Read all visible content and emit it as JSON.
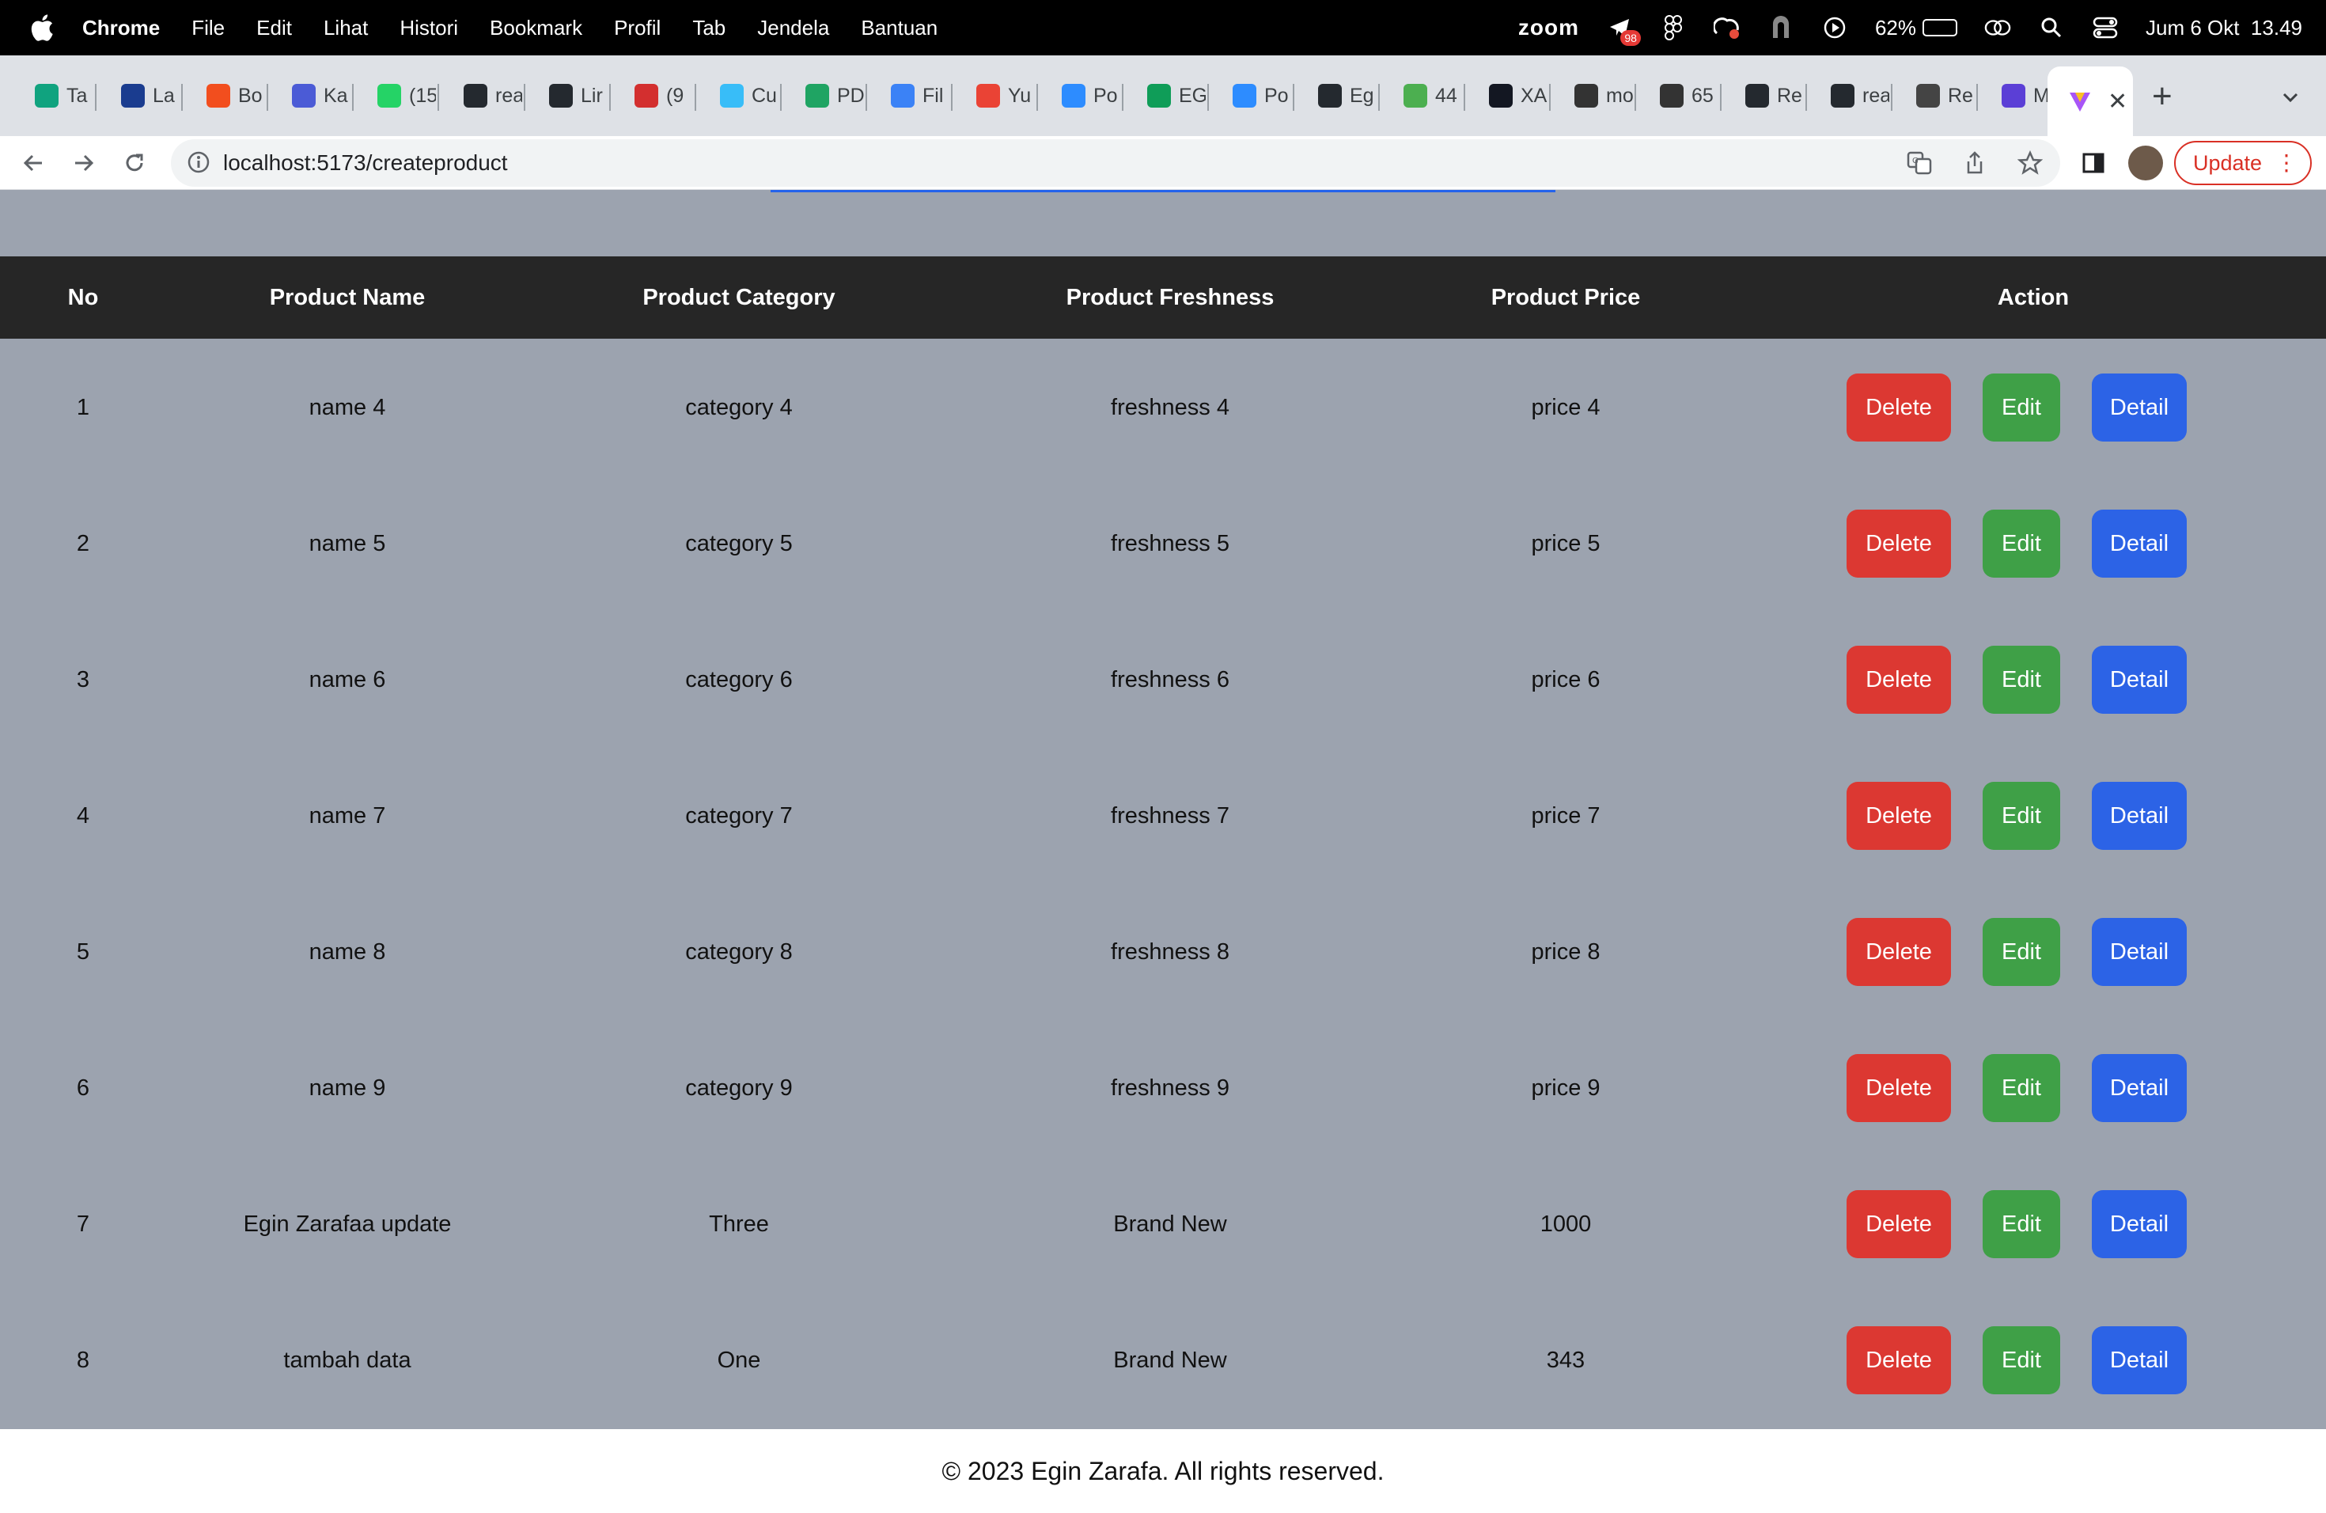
{
  "menubar": {
    "app": "Chrome",
    "items": [
      "File",
      "Edit",
      "Lihat",
      "Histori",
      "Bookmark",
      "Profil",
      "Tab",
      "Jendela",
      "Bantuan"
    ],
    "zoom": "zoom",
    "notification_count": "98",
    "battery": "62%",
    "battery_level": 0.62,
    "datetime": "Jum 6 Okt  13.49"
  },
  "tabs": [
    {
      "label": "Ta",
      "icon": "openai-icon",
      "color": "#10a37f"
    },
    {
      "label": "La",
      "icon": "one-icon",
      "color": "#1a3c8f"
    },
    {
      "label": "Bo",
      "icon": "figma-icon",
      "color": "#f24e1e"
    },
    {
      "label": "Ka",
      "icon": "calendar-icon",
      "color": "#4b5bd6"
    },
    {
      "label": "(15",
      "icon": "whatsapp-icon",
      "color": "#25d366"
    },
    {
      "label": "rea",
      "icon": "github-icon",
      "color": "#24292f"
    },
    {
      "label": "Lir",
      "icon": "github-icon",
      "color": "#24292f"
    },
    {
      "label": "(9",
      "icon": "badge-icon",
      "color": "#d32f2f"
    },
    {
      "label": "Cu",
      "icon": "tailwind-icon",
      "color": "#38bdf8"
    },
    {
      "label": "PD",
      "icon": "drive-icon",
      "color": "#1fa463"
    },
    {
      "label": "Fil",
      "icon": "forms-icon",
      "color": "#3b82f6"
    },
    {
      "label": "Yu",
      "icon": "gmail-icon",
      "color": "#ea4335"
    },
    {
      "label": "Po",
      "icon": "zoom-icon",
      "color": "#2d8cff"
    },
    {
      "label": "EG",
      "icon": "sheets-icon",
      "color": "#0f9d58"
    },
    {
      "label": "Po",
      "icon": "zoom-icon",
      "color": "#2d8cff"
    },
    {
      "label": "Eg",
      "icon": "github-icon",
      "color": "#24292f"
    },
    {
      "label": "44",
      "icon": "maps-icon",
      "color": "#4caf50"
    },
    {
      "label": "XA",
      "icon": "tradingview-icon",
      "color": "#131722"
    },
    {
      "label": "mo",
      "icon": "api-icon",
      "color": "#333333"
    },
    {
      "label": "65",
      "icon": "api-icon",
      "color": "#333333"
    },
    {
      "label": "Re",
      "icon": "github-icon",
      "color": "#24292f"
    },
    {
      "label": "rea",
      "icon": "github-icon",
      "color": "#24292f"
    },
    {
      "label": "Re",
      "icon": "monitor-icon",
      "color": "#444444"
    },
    {
      "label": "Mi",
      "icon": "list-icon",
      "color": "#5b3fd6"
    }
  ],
  "toolbar": {
    "url": "localhost:5173/createproduct",
    "update_label": "Update"
  },
  "table": {
    "headers": [
      "No",
      "Product Name",
      "Product Category",
      "Product Freshness",
      "Product Price",
      "Action"
    ],
    "rows": [
      {
        "no": "1",
        "name": "name 4",
        "category": "category 4",
        "freshness": "freshness 4",
        "price": "price 4"
      },
      {
        "no": "2",
        "name": "name 5",
        "category": "category 5",
        "freshness": "freshness 5",
        "price": "price 5"
      },
      {
        "no": "3",
        "name": "name 6",
        "category": "category 6",
        "freshness": "freshness 6",
        "price": "price 6"
      },
      {
        "no": "4",
        "name": "name 7",
        "category": "category 7",
        "freshness": "freshness 7",
        "price": "price 7"
      },
      {
        "no": "5",
        "name": "name 8",
        "category": "category 8",
        "freshness": "freshness 8",
        "price": "price 8"
      },
      {
        "no": "6",
        "name": "name 9",
        "category": "category 9",
        "freshness": "freshness 9",
        "price": "price 9"
      },
      {
        "no": "7",
        "name": "Egin Zarafaa update",
        "category": "Three",
        "freshness": "Brand New",
        "price": "1000"
      },
      {
        "no": "8",
        "name": "tambah data",
        "category": "One",
        "freshness": "Brand New",
        "price": "343"
      }
    ],
    "actions": {
      "delete": "Delete",
      "edit": "Edit",
      "detail": "Detail"
    }
  },
  "footer": {
    "text": "© 2023 Egin Zarafa. All rights reserved."
  },
  "colors": {
    "page_bg": "#9ca3af",
    "header_bg": "#262626",
    "delete": "#dc3832",
    "edit": "#3fa047",
    "detail": "#2c63e6",
    "update": "#d93025"
  }
}
